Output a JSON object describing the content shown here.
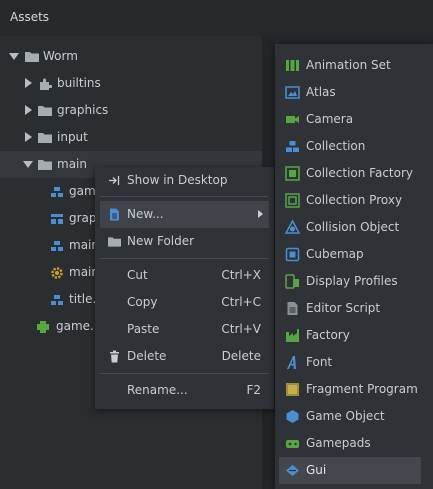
{
  "assets": {
    "title": "Assets",
    "tree": [
      {
        "label": "Worm",
        "icon": "folder-icon"
      },
      {
        "label": "builtins",
        "icon": "puzzle-icon"
      },
      {
        "label": "graphics",
        "icon": "folder-icon"
      },
      {
        "label": "input",
        "icon": "folder-icon"
      },
      {
        "label": "main",
        "icon": "folder-icon"
      },
      {
        "label": "gam",
        "icon": "collection-icon"
      },
      {
        "label": "grap",
        "icon": "gui-icon"
      },
      {
        "label": "main",
        "icon": "collection-icon"
      },
      {
        "label": "main",
        "icon": "script-gear-icon"
      },
      {
        "label": "title.",
        "icon": "collection-icon"
      },
      {
        "label": "game.p",
        "icon": "project-icon"
      }
    ]
  },
  "context_menu": {
    "show_in_desktop": "Show in Desktop",
    "new": "New...",
    "new_folder": "New Folder",
    "cut": "Cut",
    "cut_shortcut": "Ctrl+X",
    "copy": "Copy",
    "copy_shortcut": "Ctrl+C",
    "paste": "Paste",
    "paste_shortcut": "Ctrl+V",
    "delete": "Delete",
    "delete_shortcut": "Delete",
    "rename": "Rename...",
    "rename_shortcut": "F2"
  },
  "submenu": {
    "items": [
      "Animation Set",
      "Atlas",
      "Camera",
      "Collection",
      "Collection Factory",
      "Collection Proxy",
      "Collision Object",
      "Cubemap",
      "Display Profiles",
      "Editor Script",
      "Factory",
      "Font",
      "Fragment Program",
      "Game Object",
      "Gamepads",
      "Gui"
    ]
  },
  "colors": {
    "accent_blue": "#4a8fd4",
    "accent_green": "#55a744",
    "highlight": "#44484e"
  }
}
